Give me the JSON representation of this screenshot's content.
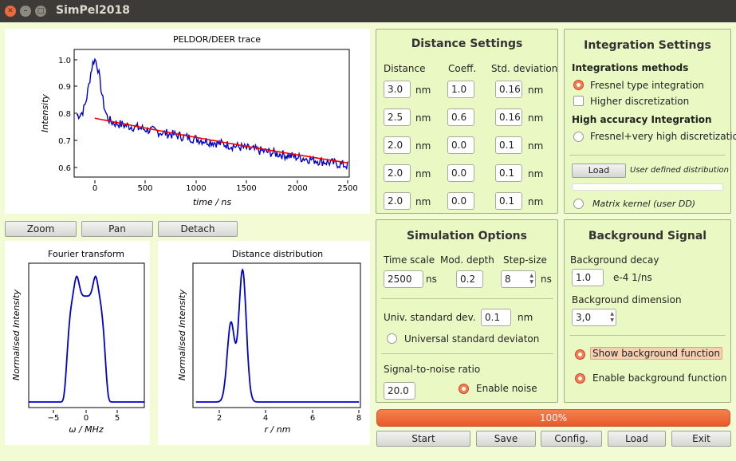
{
  "window": {
    "title": "SimPel2018"
  },
  "plots": {
    "trace": {
      "title": "PELDOR/DEER trace",
      "xlabel": "time / ns",
      "ylabel": "Intensity",
      "xticks": [
        "0",
        "500",
        "1000",
        "1500",
        "2000",
        "2500"
      ],
      "yticks": [
        "1.0",
        "0.9",
        "0.8",
        "0.7",
        "0.6"
      ]
    },
    "fourier": {
      "title": "Fourier transform",
      "xlabel": "ω / MHz",
      "ylabel": "Normalised  Intensity",
      "xticks": [
        "−5",
        "0",
        "5"
      ]
    },
    "distance": {
      "title": "Distance distribution",
      "xlabel": "r / nm",
      "ylabel": "Normalised  Intensity",
      "xticks": [
        "2",
        "4",
        "6",
        "8"
      ]
    }
  },
  "toolbar": {
    "zoom": "Zoom",
    "pan": "Pan",
    "detach": "Detach"
  },
  "distance_settings": {
    "title": "Distance Settings",
    "headers": {
      "distance": "Distance",
      "coeff": "Coeff.",
      "std": "Std. deviation"
    },
    "unit": "nm",
    "rows": [
      {
        "distance": "3.0",
        "coeff": "1.0",
        "std": "0.16"
      },
      {
        "distance": "2.5",
        "coeff": "0.6",
        "std": "0.16"
      },
      {
        "distance": "2.0",
        "coeff": "0.0",
        "std": "0.1"
      },
      {
        "distance": "2.0",
        "coeff": "0.0",
        "std": "0.1"
      },
      {
        "distance": "2.0",
        "coeff": "0.0",
        "std": "0.1"
      }
    ]
  },
  "integration": {
    "title": "Integration Settings",
    "methods_label": "Integrations methods",
    "fresnel": "Fresnel type integration",
    "higher": "Higher discretization",
    "high_acc_label": "High accuracy Integration",
    "fresnel_very": "Fresnel+very high discretization",
    "load": "Load",
    "user_defined": "User defined distribution",
    "matrix": "Matrix kernel  (user DD)"
  },
  "simulation": {
    "title": "Simulation Options",
    "time_scale": "Time scale",
    "mod_depth": "Mod. depth",
    "step_size": "Step-size",
    "time_value": "2500",
    "ns": "ns",
    "mod_value": "0.2",
    "step_value": "8",
    "univ_std": "Univ. standard dev.",
    "univ_std_value": "0.1",
    "nm": "nm",
    "univ_std_radio": "Universal standard deviaton",
    "snr": "Signal-to-noise ratio",
    "snr_value": "20.0",
    "enable_noise": "Enable noise"
  },
  "background": {
    "title": "Background Signal",
    "decay": "Background decay",
    "decay_value": "1.0",
    "decay_unit": "e-4  1/ns",
    "dimension": "Background dimension",
    "dimension_value": "3,0",
    "show": "Show background function",
    "enable": "Enable background function"
  },
  "progress": {
    "label": "100%",
    "value": 1.0
  },
  "actions": {
    "start": "Start",
    "save": "Save",
    "config": "Config.",
    "load": "Load",
    "exit": "Exit"
  },
  "colors": {
    "accent": "#f0693c",
    "series": "#0000cc",
    "fit": "#ee0000",
    "bg": "#f2fbd4"
  }
}
